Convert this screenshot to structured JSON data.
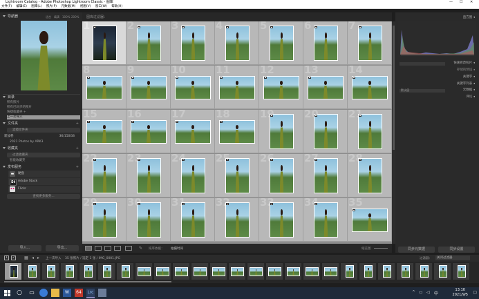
{
  "window": {
    "title": "Lightroom Catalog - Adobe Photoshop Lightroom Classic - 图库",
    "controls": [
      "—",
      "☐",
      "✕"
    ]
  },
  "menu": [
    "文件(F)",
    "编辑(E)",
    "图库(L)",
    "照片(P)",
    "元数据(M)",
    "视图(V)",
    "窗口(W)",
    "帮助(H)"
  ],
  "left_panel": {
    "navigator": {
      "title": "导航器",
      "zoom": [
        "适合",
        "填满",
        "100%",
        "200%"
      ]
    },
    "catalog": {
      "title": "目录",
      "items": [
        "所有照片",
        "所有已同步的照片",
        "快捷收藏夹 +",
        "上一次导入"
      ]
    },
    "folders": {
      "title": "文件夹",
      "filter": "滤镜文件夹",
      "volume": "新加卷",
      "volume_size": "36/150GB",
      "folder": "2021 Photos by ARK3"
    },
    "collections": {
      "title": "收藏夹",
      "filter": "过滤收藏夹",
      "smart": "智能收藏夹"
    },
    "publish": {
      "title": "发布服务",
      "services": [
        {
          "label": "硬盘",
          "icon": "hard-drive"
        },
        {
          "label": "Adobe Stock",
          "icon": "St"
        },
        {
          "label": "Flickr",
          "icon": "flickr"
        }
      ],
      "more": "查找更多服务..."
    },
    "import_label": "导入...",
    "export_label": "导出..."
  },
  "grid": {
    "header": "图库过滤器：",
    "thumbs": [
      {
        "n": "1",
        "orient": "portrait",
        "dark": true,
        "sel": true
      },
      {
        "n": "2",
        "orient": "portrait"
      },
      {
        "n": "3",
        "orient": "portrait"
      },
      {
        "n": "4",
        "orient": "portrait"
      },
      {
        "n": "5",
        "orient": "portrait"
      },
      {
        "n": "6",
        "orient": "portrait"
      },
      {
        "n": "7",
        "orient": "portrait"
      },
      {
        "n": "8",
        "orient": "landscape"
      },
      {
        "n": "9",
        "orient": "landscape"
      },
      {
        "n": "10",
        "orient": "landscape"
      },
      {
        "n": "11",
        "orient": "landscape"
      },
      {
        "n": "12",
        "orient": "landscape"
      },
      {
        "n": "13",
        "orient": "landscape"
      },
      {
        "n": "14",
        "orient": "landscape"
      },
      {
        "n": "15",
        "orient": "landscape"
      },
      {
        "n": "16",
        "orient": "landscape"
      },
      {
        "n": "17",
        "orient": "landscape"
      },
      {
        "n": "18",
        "orient": "landscape"
      },
      {
        "n": "19",
        "orient": "portrait"
      },
      {
        "n": "20",
        "orient": "portrait"
      },
      {
        "n": "21",
        "orient": "portrait"
      },
      {
        "n": "22",
        "orient": "portrait"
      },
      {
        "n": "23",
        "orient": "portrait"
      },
      {
        "n": "24",
        "orient": "portrait"
      },
      {
        "n": "25",
        "orient": "portrait"
      },
      {
        "n": "26",
        "orient": "portrait"
      },
      {
        "n": "27",
        "orient": "portrait"
      },
      {
        "n": "28",
        "orient": "portrait"
      },
      {
        "n": "29",
        "orient": "portrait"
      },
      {
        "n": "30",
        "orient": "portrait"
      },
      {
        "n": "31",
        "orient": "portrait"
      },
      {
        "n": "32",
        "orient": "portrait"
      },
      {
        "n": "33",
        "orient": "portrait"
      },
      {
        "n": "34",
        "orient": "portrait"
      },
      {
        "n": "35",
        "orient": "landscape"
      }
    ],
    "toolbar": {
      "sort_label": "排序依据：",
      "sort_value": "拍摄时间",
      "thumb_label": "缩览图"
    }
  },
  "right_panel": {
    "histogram_title": "直方图",
    "quick_develop": "快速修改照片",
    "preset_label": "存储的预设",
    "preset_value": "默认设置",
    "keywording": "关键字",
    "keyword_list": "关键字列表",
    "metadata": "元数据",
    "metadata_value": "默认值",
    "comments": "评论",
    "sync_meta": "同步元数据",
    "sync_settings": "同步设置"
  },
  "filmstrip": {
    "path": "上一次导入",
    "info": "35 张照片 / 选定 1 张 / IMG_0001.JPG",
    "filter_label": "过滤器：",
    "filter_value": "关闭过滤器",
    "count": 25
  },
  "taskbar": {
    "time": "13:10",
    "date": "2021/9/5",
    "apps": [
      "start",
      "search",
      "task-view",
      "edge",
      "explorer",
      "word",
      "obs",
      "lightroom",
      "lightroom-classic",
      "photos"
    ]
  },
  "colors": {
    "grid_bg": "#8d8d8d",
    "cell_bg": "#b8b8b8",
    "panel_bg": "#2a2a2a",
    "taskbar": "#1f2a3a"
  }
}
